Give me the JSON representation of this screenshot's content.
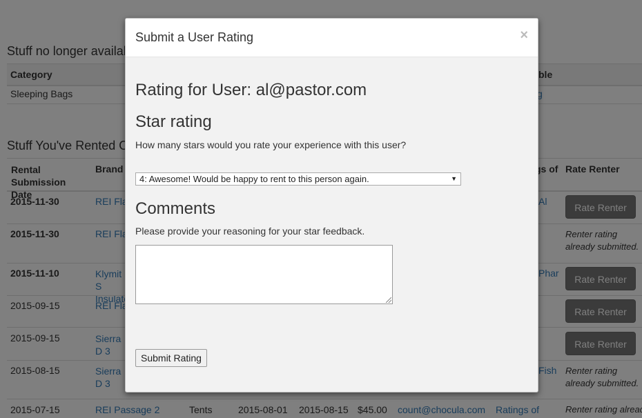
{
  "background": {
    "section1_title": "Stuff no longer available",
    "section1_headers": [
      "Category",
      "ble"
    ],
    "section1_row": {
      "category": "Sleeping Bags",
      "link_tail": "g"
    },
    "section2_title": "Stuff You've Rented Out",
    "section2_headers": {
      "date": "Rental Submission Date",
      "brand": "Brand a",
      "ratings": "gs of",
      "rate": "Rate Renter"
    },
    "rows": [
      {
        "date": "2015-11-30",
        "brand": "REI Fla",
        "ratings": "Al",
        "action": "Rate Renter"
      },
      {
        "date": "2015-11-30",
        "brand": "REI Fla",
        "ratings": "",
        "action": "Renter rating already submitted."
      },
      {
        "date": "2015-11-10",
        "brand": "Klymit S Insulate",
        "ratings": "Phar",
        "action": "Rate Renter"
      },
      {
        "date": "2015-09-15",
        "brand": "REI Fla",
        "ratings": "",
        "action": "Rate Renter"
      },
      {
        "date": "2015-09-15",
        "brand": "Sierra D 3",
        "ratings": "",
        "action": "Rate Renter"
      },
      {
        "date": "2015-08-15",
        "brand": "Sierra D 3",
        "ratings": "Fish",
        "action": "Renter rating already submitted."
      },
      {
        "date": "2015-07-15",
        "brand": "REI Passage 2",
        "category": "Tents",
        "start": "2015-08-01",
        "end": "2015-08-15",
        "price": "$45.00",
        "user": "count@chocula.com",
        "ratings": "Ratings of",
        "action": "Renter rating already"
      }
    ]
  },
  "modal": {
    "title": "Submit a User Rating",
    "close": "×",
    "heading": "Rating for User: al@pastor.com",
    "star_heading": "Star rating",
    "star_prompt": "How many stars would you rate your experience with this user?",
    "star_selected": "4: Awesome! Would be happy to rent to this person again.",
    "comments_heading": "Comments",
    "comments_prompt": "Please provide your reasoning for your star feedback.",
    "comments_value": "",
    "submit_label": "Submit Rating"
  }
}
